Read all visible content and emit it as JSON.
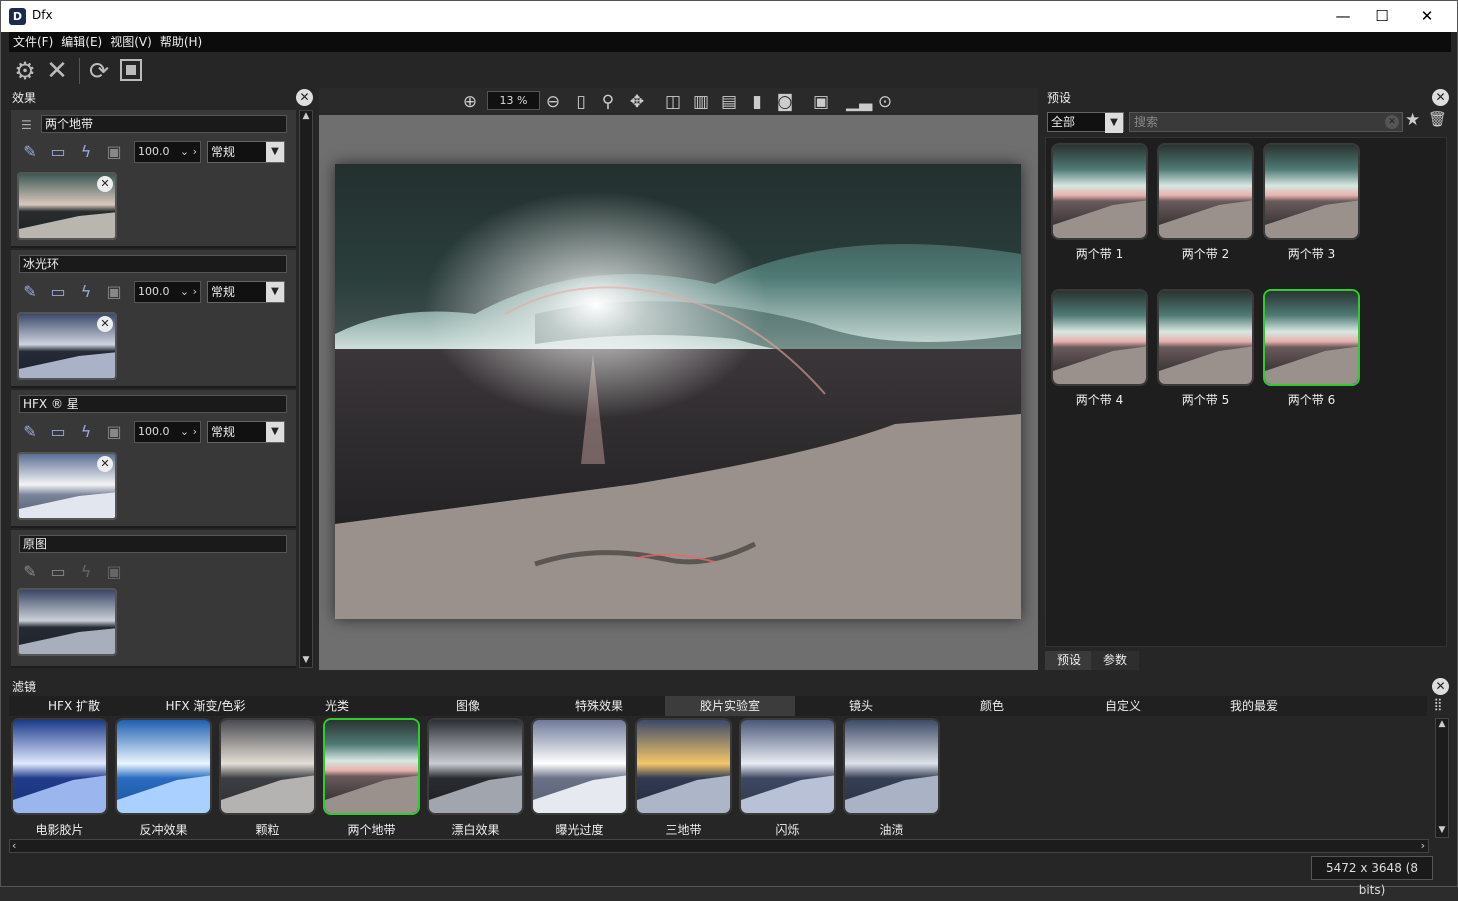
{
  "app": {
    "title": "Dfx",
    "logo": "D"
  },
  "window_controls": {
    "minimize": "—",
    "maximize": "☐",
    "close": "✕"
  },
  "menu": [
    "文件(F)",
    "编辑(E)",
    "视图(V)",
    "帮助(H)"
  ],
  "effects_panel": {
    "title": "效果",
    "layers": [
      {
        "name": "两个地带",
        "opacity": "100.0",
        "blend": "常规"
      },
      {
        "name": "冰光环",
        "opacity": "100.0",
        "blend": "常规"
      },
      {
        "name": "HFX ® 星",
        "opacity": "100.0",
        "blend": "常规"
      },
      {
        "name": "原图"
      }
    ]
  },
  "viewer": {
    "zoom": "13 %"
  },
  "presets_panel": {
    "title": "预设",
    "filter_select": "全部",
    "search_placeholder": "搜索",
    "items": [
      "两个带 1",
      "两个带 2",
      "两个带 3",
      "两个带 4",
      "两个带 5",
      "两个带 6"
    ],
    "selected_index": 5,
    "tabs": [
      "预设",
      "参数"
    ]
  },
  "filters_panel": {
    "title": "滤镜",
    "tabs": [
      "HFX 扩散",
      "HFX 渐变/色彩",
      "光类",
      "图像",
      "特殊效果",
      "胶片实验室",
      "镜头",
      "颜色",
      "自定义",
      "我的最爱"
    ],
    "active_tab_index": 5,
    "items": [
      "电影胶片",
      "反冲效果",
      "颗粒",
      "两个地带",
      "漂白效果",
      "曝光过度",
      "三地带",
      "闪烁",
      "油渍"
    ],
    "selected_index": 3
  },
  "status": {
    "image_info": "5472 x 3648 (8 bits)"
  },
  "colors": {
    "selection": "#2ecc2e",
    "background": "#262626",
    "viewer_bg": "#6f6f6f"
  }
}
